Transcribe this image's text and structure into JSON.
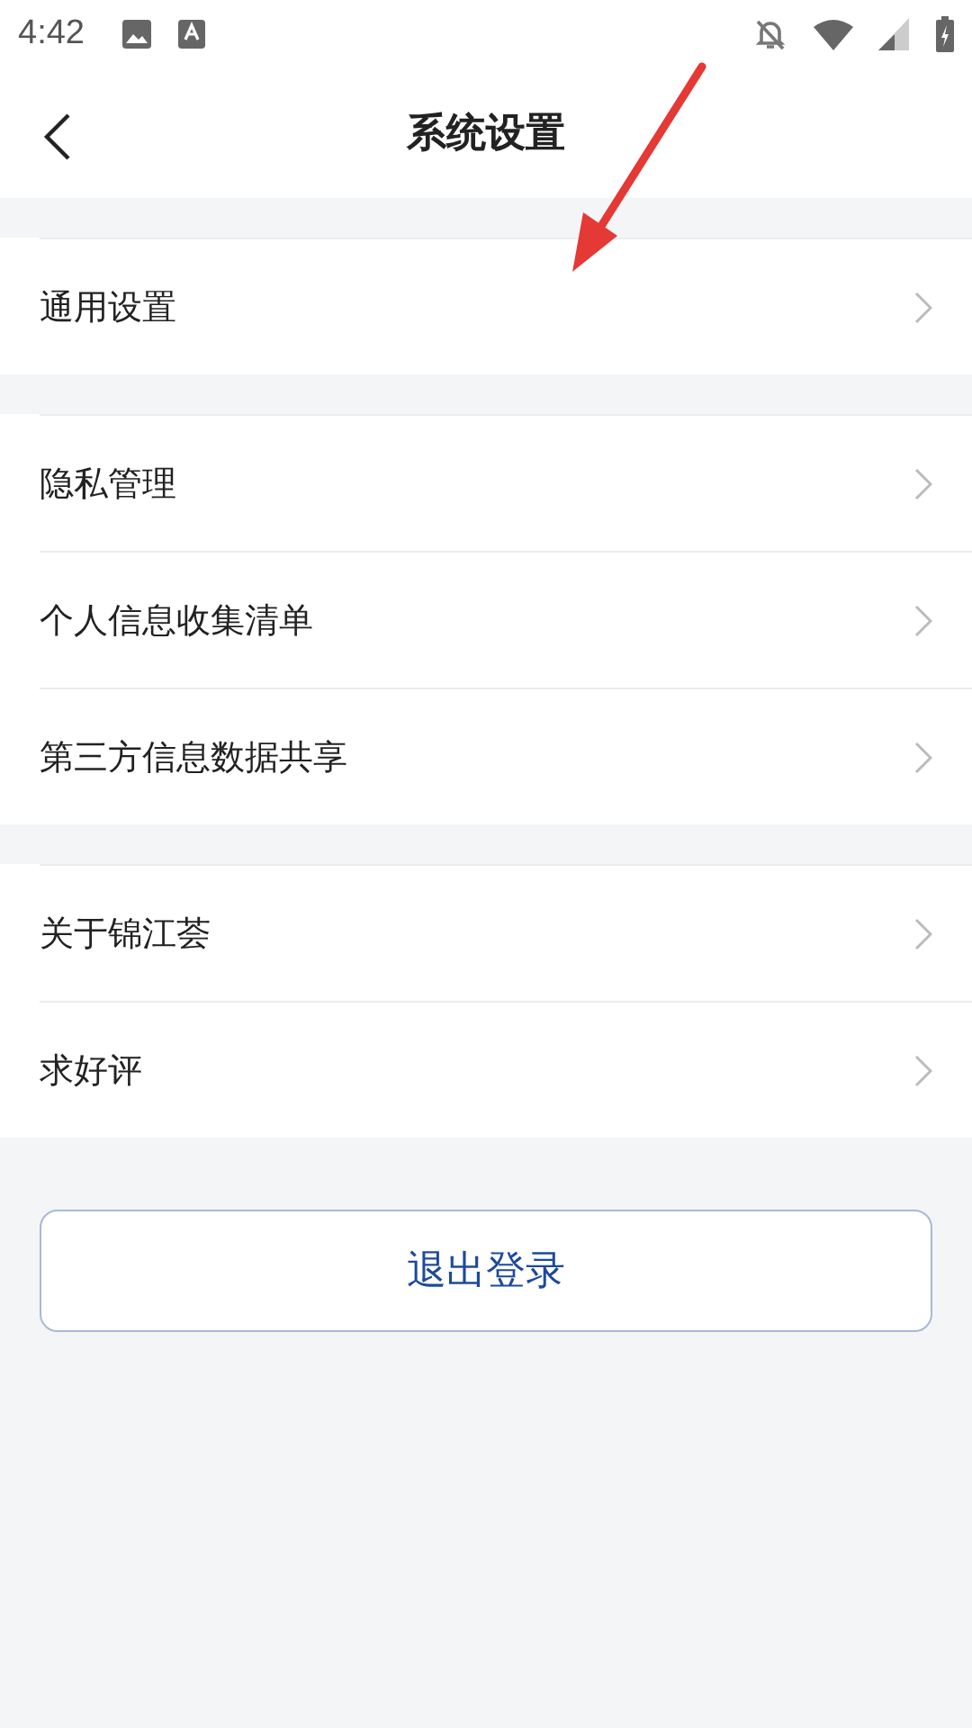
{
  "status_bar": {
    "time": "4:42"
  },
  "header": {
    "title": "系统设置"
  },
  "groups": [
    {
      "items": [
        {
          "label": "通用设置"
        }
      ]
    },
    {
      "items": [
        {
          "label": "隐私管理"
        },
        {
          "label": "个人信息收集清单"
        },
        {
          "label": "第三方信息数据共享"
        }
      ]
    },
    {
      "items": [
        {
          "label": "关于锦江荟"
        },
        {
          "label": "求好评"
        }
      ]
    }
  ],
  "logout_button": {
    "label": "退出登录"
  },
  "annotation": {
    "kind": "arrow"
  }
}
